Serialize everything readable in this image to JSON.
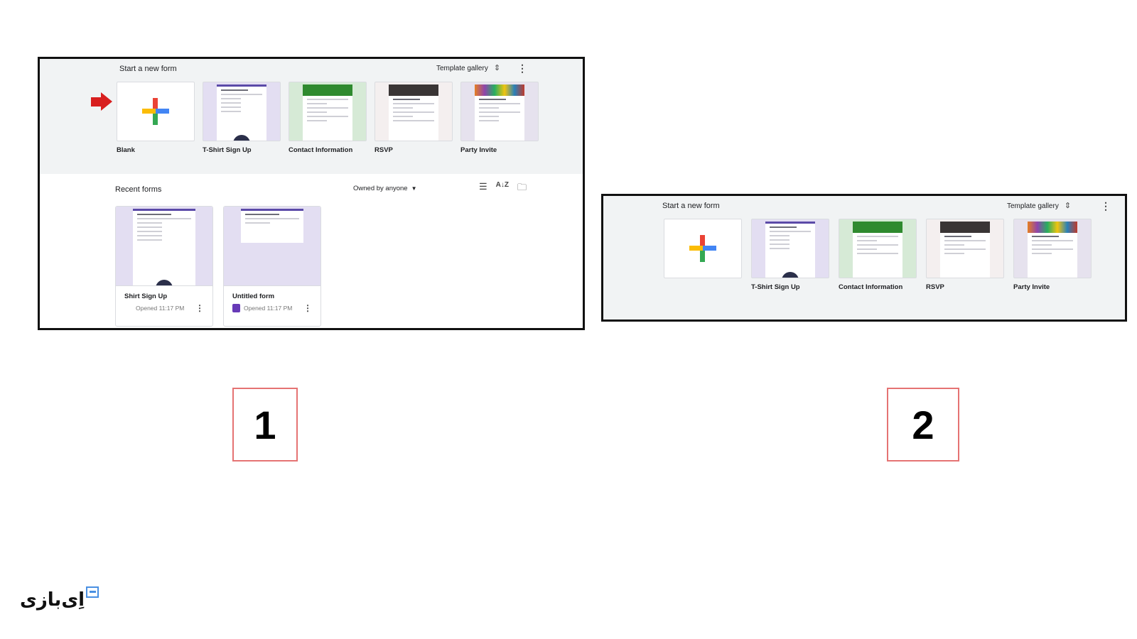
{
  "panel1": {
    "start_title": "Start a new form",
    "gallery_label": "Template gallery",
    "templates": [
      {
        "label": "Blank"
      },
      {
        "label": "T-Shirt Sign Up"
      },
      {
        "label": "Contact Information"
      },
      {
        "label": "RSVP"
      },
      {
        "label": "Party Invite"
      }
    ],
    "recent_title": "Recent forms",
    "owned_label": "Owned by anyone",
    "recent": [
      {
        "name": "Shirt Sign Up",
        "opened": "Opened 11:17 PM"
      },
      {
        "name": "Untitled form",
        "opened": "Opened 11:17 PM"
      }
    ]
  },
  "panel2": {
    "start_title": "Start a new form",
    "gallery_label": "Template gallery",
    "templates": [
      {
        "label": ""
      },
      {
        "label": "T-Shirt Sign Up"
      },
      {
        "label": "Contact Information"
      },
      {
        "label": "RSVP"
      },
      {
        "label": "Party Invite"
      }
    ]
  },
  "numbers": {
    "one": "1",
    "two": "2"
  },
  "logo_text": "اِی‌بازی",
  "colors": {
    "arrow": "#d81f1f",
    "box_border": "#e57373",
    "form_purple": "#673ab7"
  }
}
